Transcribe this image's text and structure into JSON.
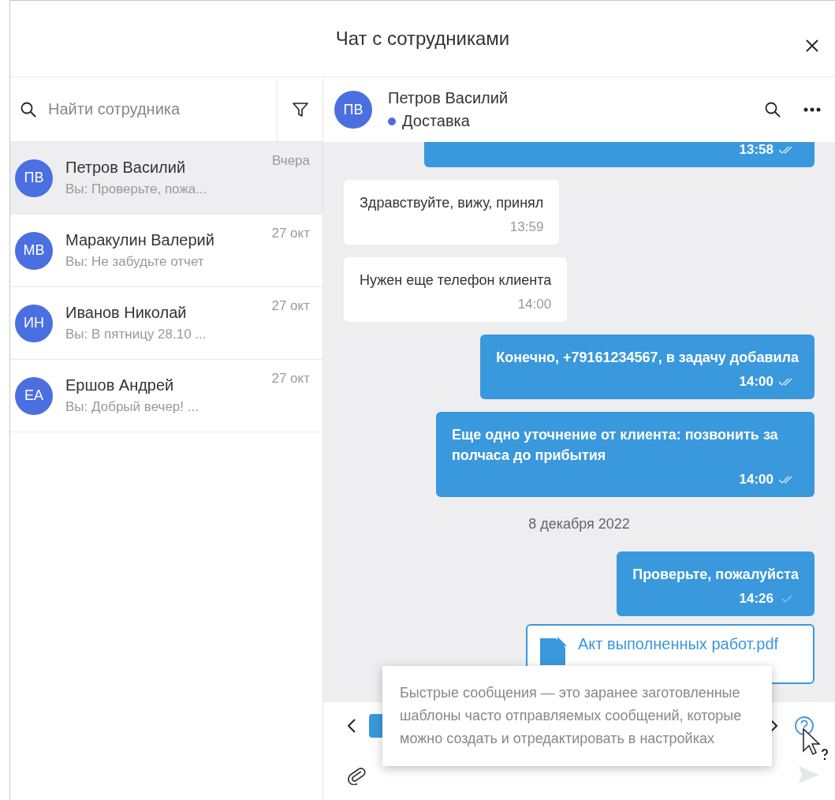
{
  "window": {
    "title": "Чат с сотрудниками"
  },
  "search": {
    "placeholder": "Найти сотрудника"
  },
  "contacts": [
    {
      "initials": "ПВ",
      "name": "Петров Василий",
      "preview": "Вы: Проверьте, пожа...",
      "date": "Вчера",
      "selected": true
    },
    {
      "initials": "МВ",
      "name": "Маракулин Валерий",
      "preview": "Вы: Не забудьте отчет",
      "date": "27 окт",
      "selected": false
    },
    {
      "initials": "ИН",
      "name": "Иванов Николай",
      "preview": "Вы: В пятницу 28.10 ...",
      "date": "27 окт",
      "selected": false
    },
    {
      "initials": "ЕА",
      "name": "Ершов Андрей",
      "preview": "Вы: Добрый вечер! ...",
      "date": "27 окт",
      "selected": false
    }
  ],
  "chat_header": {
    "initials": "ПВ",
    "name": "Петров Василий",
    "status": "Доставка",
    "color": "#4a6fe0"
  },
  "messages": [
    {
      "kind": "out",
      "time": "13:58",
      "read": true
    },
    {
      "kind": "in",
      "text": "Здравствуйте, вижу, принял",
      "time": "13:59"
    },
    {
      "kind": "in",
      "text": "Нужен еще телефон клиента",
      "time": "14:00"
    },
    {
      "kind": "out",
      "text": "Конечно, +79161234567, в задачу добавила",
      "time": "14:00",
      "read": true
    },
    {
      "kind": "out",
      "text": "Еще одно уточнение от клиента: позвонить за полчаса до прибытия",
      "time": "14:00",
      "read": true
    },
    {
      "kind": "date",
      "text": "8 декабря 2022"
    },
    {
      "kind": "out",
      "text": "Проверьте, пожалуйста",
      "time": "14:26",
      "read": false
    },
    {
      "kind": "file",
      "text": "Акт выполненных работ.pdf"
    }
  ],
  "tooltip": {
    "text": "Быстрые сообщения — это заранее заготовленные шаблоны часто отправляемых сообщений, которые можно создать и отредактировать в настройках"
  },
  "composer": {
    "send_disabled": true
  }
}
